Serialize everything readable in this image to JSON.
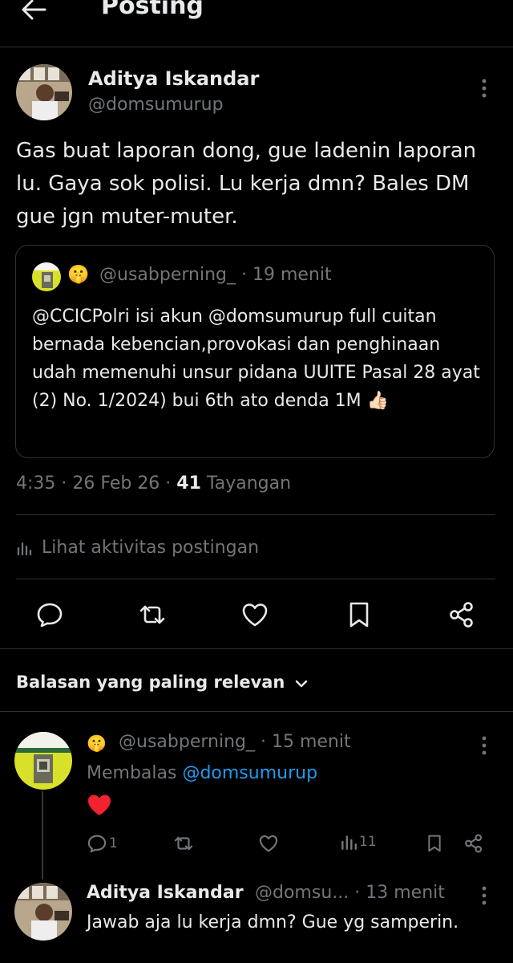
{
  "header": {
    "title": "Posting"
  },
  "post": {
    "author_name": "Aditya Iskandar",
    "author_handle": "@domsumurup",
    "text": "Gas buat laporan dong, gue ladenin laporan lu. Gaya sok polisi. Lu kerja dmn? Bales DM gue jgn muter-muter.",
    "quote": {
      "emoji": "🤫",
      "handle": "@usabperning_",
      "time": "· 19 menit",
      "text": "@CCICPolri isi akun @domsumurup full cuitan bernada kebencian,provokasi dan penghinaan udah memenuhi unsur pidana UUITE Pasal 28 ayat (2) No. 1/2024) bui 6th ato denda 1M 👍🏻"
    },
    "meta": {
      "time": "4:35 · 26 Feb 26 · ",
      "views_count": "41",
      "views_label": " Tayangan"
    },
    "activity_label": "Lihat aktivitas postingan"
  },
  "actions": [
    "reply-icon",
    "repost-icon",
    "like-icon",
    "bookmark-icon",
    "share-icon"
  ],
  "replies_section": {
    "sort_label": "Balasan yang paling relevan"
  },
  "reply1": {
    "emoji": "🤫",
    "handle": "@usabperning_",
    "time": "· 15 menit",
    "replying_prefix": "Membalas ",
    "replying_to": "@domsumurup",
    "text": "❤️",
    "reply_count": "1",
    "views_count": "11"
  },
  "reply2": {
    "author_name": "Aditya Iskandar",
    "author_handle": "@domsu...",
    "time": "· 13 menit",
    "text": "Jawab aja lu kerja dmn? Gue yg samperin."
  },
  "colors": {
    "background": "#000000",
    "text": "#e7e9ea",
    "muted": "#71767b",
    "link": "#1d9bf0",
    "divider": "#2f3336",
    "heart": "#f91880"
  }
}
